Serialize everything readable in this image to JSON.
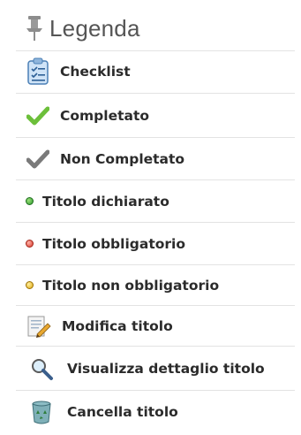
{
  "legend": {
    "title": "Legenda",
    "items": [
      {
        "label": "Checklist",
        "icon": "clipboard-icon"
      },
      {
        "label": "Completato",
        "icon": "green-check-icon",
        "color": "#6cbf3a"
      },
      {
        "label": "Non Completato",
        "icon": "gray-check-icon",
        "color": "#7a7a7a"
      },
      {
        "label": "Titolo dichiarato",
        "icon": "green-dot-icon",
        "color": "#3aa83a"
      },
      {
        "label": "Titolo obbligatorio",
        "icon": "red-dot-icon",
        "color": "#e0453a"
      },
      {
        "label": "Titolo non obbligatorio",
        "icon": "yellow-dot-icon",
        "color": "#e6b81e"
      },
      {
        "label": "Modifica titolo",
        "icon": "edit-document-icon"
      },
      {
        "label": "Visualizza dettaglio titolo",
        "icon": "magnifier-icon"
      },
      {
        "label": "Cancella titolo",
        "icon": "recycle-bin-icon"
      }
    ]
  }
}
